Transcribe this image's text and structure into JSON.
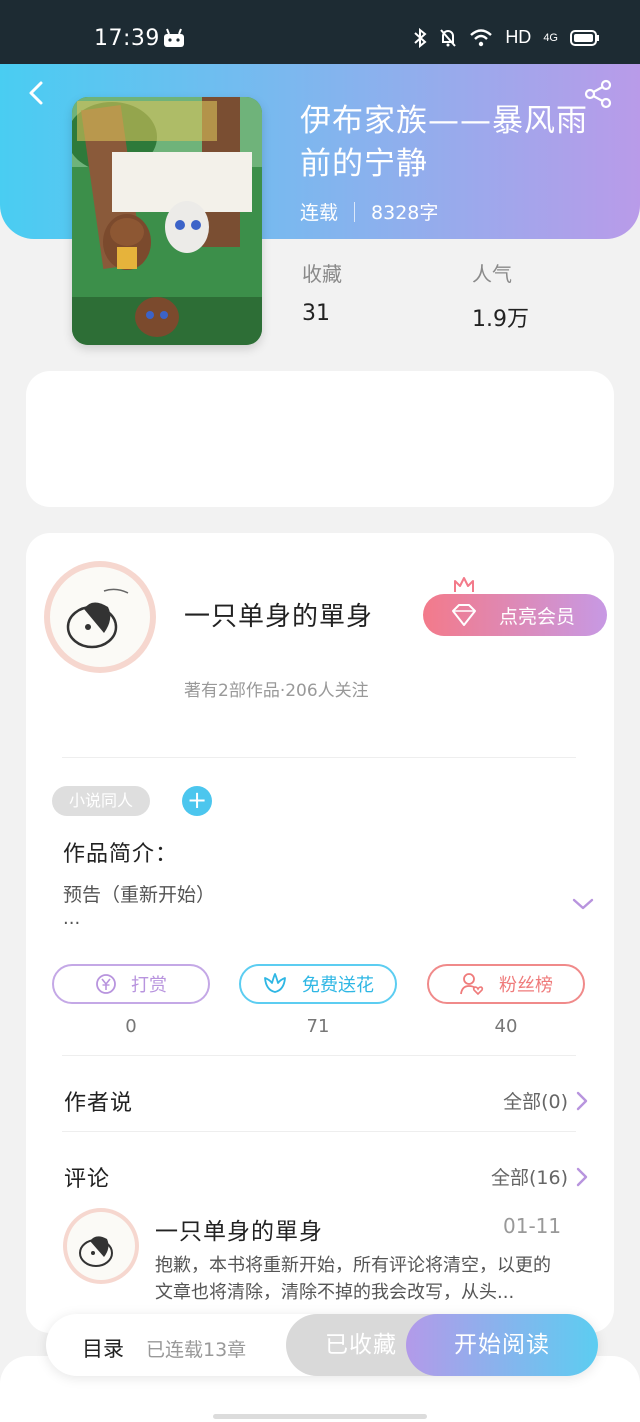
{
  "status_bar": {
    "time": "17:39",
    "hd": "HD",
    "network": "4G"
  },
  "book": {
    "title": "伊布家族——暴风雨前的宁静",
    "status": "连载",
    "word_count": "8328字",
    "stats": [
      {
        "label": "收藏",
        "value": "31"
      },
      {
        "label": "人气",
        "value": "1.9万"
      }
    ]
  },
  "author": {
    "name": "一只单身的單身",
    "vip_label": "点亮会员",
    "stats": "著有2部作品·206人关注"
  },
  "tag": "小说同人",
  "intro": {
    "title": "作品简介：",
    "text": "预告（重新开始）",
    "more": "..."
  },
  "actions": [
    {
      "label": "打赏",
      "count": "0",
      "color": "#b894de"
    },
    {
      "label": "免费送花",
      "count": "71",
      "color": "#4cc6ee"
    },
    {
      "label": "粉丝榜",
      "count": "40",
      "color": "#ef7b7b"
    }
  ],
  "author_says": {
    "title": "作者说",
    "link": "全部(0)"
  },
  "comments": {
    "title": "评论",
    "link": "全部(16)",
    "items": [
      {
        "user": "一只单身的單身",
        "date": "01-11",
        "text": "抱歉，本书将重新开始，所有评论将清空，以更的文章也将清除，清除不掉的我会改写，从头..."
      }
    ]
  },
  "bottom": {
    "toc_label": "目录",
    "toc_count": "已连载13章",
    "favorite_label": "已收藏",
    "read_label": "开始阅读"
  }
}
